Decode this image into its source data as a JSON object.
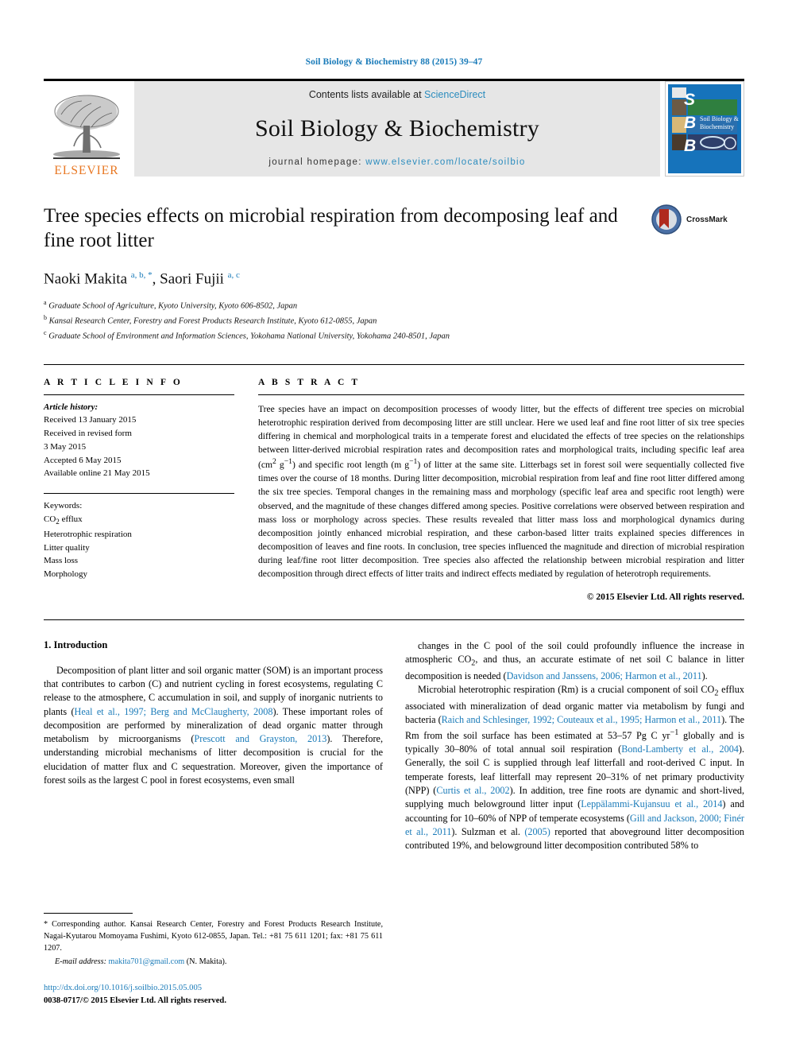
{
  "running_head": "Soil Biology & Biochemistry 88 (2015) 39–47",
  "masthead": {
    "publisher_logo_label": "ELSEVIER",
    "contents_prefix": "Contents lists available at ",
    "contents_link": "ScienceDirect",
    "journal_name": "Soil Biology & Biochemistry",
    "homepage_prefix": "journal homepage: ",
    "homepage_url": "www.elsevier.com/locate/soilbio",
    "cover_letters": [
      "S",
      "B",
      "B"
    ],
    "cover_title": "Soil Biology & Biochemistry"
  },
  "article": {
    "title": "Tree species effects on microbial respiration from decomposing leaf and fine root litter",
    "crossmark_label": "CrossMark",
    "authors_html": "Naoki Makita <sup>a, b, *</sup>, Saori Fujii <sup>a, c</sup>",
    "affiliations": [
      {
        "marker": "a",
        "text": "Graduate School of Agriculture, Kyoto University, Kyoto 606-8502, Japan"
      },
      {
        "marker": "b",
        "text": "Kansai Research Center, Forestry and Forest Products Research Institute, Kyoto 612-0855, Japan"
      },
      {
        "marker": "c",
        "text": "Graduate School of Environment and Information Sciences, Yokohama National University, Yokohama 240-8501, Japan"
      }
    ]
  },
  "article_info": {
    "heading": "A R T I C L E   I N F O",
    "history_label": "Article history:",
    "history_lines": [
      "Received 13 January 2015",
      "Received in revised form",
      "3 May 2015",
      "Accepted 6 May 2015",
      "Available online 21 May 2015"
    ],
    "keywords_label": "Keywords:",
    "keywords": [
      "CO2 efflux",
      "Heterotrophic respiration",
      "Litter quality",
      "Mass loss",
      "Morphology"
    ]
  },
  "abstract": {
    "heading": "A B S T R A C T",
    "text": "Tree species have an impact on decomposition processes of woody litter, but the effects of different tree species on microbial heterotrophic respiration derived from decomposing litter are still unclear. Here we used leaf and fine root litter of six tree species differing in chemical and morphological traits in a temperate forest and elucidated the effects of tree species on the relationships between litter-derived microbial respiration rates and decomposition rates and morphological traits, including specific leaf area (cm2 g−1) and specific root length (m g−1) of litter at the same site. Litterbags set in forest soil were sequentially collected five times over the course of 18 months. During litter decomposition, microbial respiration from leaf and fine root litter differed among the six tree species. Temporal changes in the remaining mass and morphology (specific leaf area and specific root length) were observed, and the magnitude of these changes differed among species. Positive correlations were observed between respiration and mass loss or morphology across species. These results revealed that litter mass loss and morphological dynamics during decomposition jointly enhanced microbial respiration, and these carbon-based litter traits explained species differences in decomposition of leaves and fine roots. In conclusion, tree species influenced the magnitude and direction of microbial respiration during leaf/fine root litter decomposition. Tree species also affected the relationship between microbial respiration and litter decomposition through direct effects of litter traits and indirect effects mediated by regulation of heterotroph requirements.",
    "copyright": "© 2015 Elsevier Ltd. All rights reserved."
  },
  "body": {
    "section_title": "1. Introduction",
    "left_paragraphs": [
      "Decomposition of plant litter and soil organic matter (SOM) is an important process that contributes to carbon (C) and nutrient cycling in forest ecosystems, regulating C release to the atmosphere, C accumulation in soil, and supply of inorganic nutrients to plants (Heal et al., 1997; Berg and McClaugherty, 2008). These important roles of decomposition are performed by mineralization of dead organic matter through metabolism by microorganisms (Prescott and Grayston, 2013). Therefore, understanding microbial mechanisms of litter decomposition is crucial for the elucidation of matter flux and C sequestration. Moreover, given the importance of forest soils as the largest C pool in forest ecosystems, even small"
    ],
    "right_paragraphs": [
      "changes in the C pool of the soil could profoundly influence the increase in atmospheric CO2, and thus, an accurate estimate of net soil C balance in litter decomposition is needed (Davidson and Janssens, 2006; Harmon et al., 2011).",
      "Microbial heterotrophic respiration (Rm) is a crucial component of soil CO2 efflux associated with mineralization of dead organic matter via metabolism by fungi and bacteria (Raich and Schlesinger, 1992; Couteaux et al., 1995; Harmon et al., 2011). The Rm from the soil surface has been estimated at 53–57 Pg C yr−1 globally and is typically 30–80% of total annual soil respiration (Bond-Lamberty et al., 2004). Generally, the soil C is supplied through leaf litterfall and root-derived C input. In temperate forests, leaf litterfall may represent 20–31% of net primary productivity (NPP) (Curtis et al., 2002). In addition, tree fine roots are dynamic and short-lived, supplying much belowground litter input (Leppälammi-Kujansuu et al., 2014) and accounting for 10–60% of NPP of temperate ecosystems (Gill and Jackson, 2000; Finér et al., 2011). Sulzman et al. (2005) reported that aboveground litter decomposition contributed 19%, and belowground litter decomposition contributed 58% to"
    ]
  },
  "footnote": {
    "corresponding": "* Corresponding author. Kansai Research Center, Forestry and Forest Products Research Institute, Nagai-Kyutarou Momoyama Fushimi, Kyoto 612-0855, Japan. Tel.: +81 75 611 1201; fax: +81 75 611 1207.",
    "email_label": "E-mail address:",
    "email": "makita701@gmail.com",
    "email_suffix": "(N. Makita).",
    "doi": "http://dx.doi.org/10.1016/j.soilbio.2015.05.005",
    "issn_line": "0038-0717/© 2015 Elsevier Ltd. All rights reserved."
  },
  "colors": {
    "link_blue": "#1a7bb9",
    "elsevier_orange": "#e87722",
    "cover_blue": "#1673bb",
    "masthead_gray": "#e6e6e6"
  }
}
